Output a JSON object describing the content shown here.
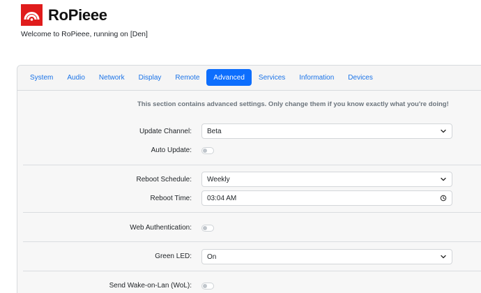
{
  "brand": {
    "title": "RoPieee",
    "logo_color": "#e01c1c"
  },
  "welcome": "Welcome to RoPieee, running on [Den]",
  "tabs": [
    {
      "label": "System",
      "active": false
    },
    {
      "label": "Audio",
      "active": false
    },
    {
      "label": "Network",
      "active": false
    },
    {
      "label": "Display",
      "active": false
    },
    {
      "label": "Remote",
      "active": false
    },
    {
      "label": "Advanced",
      "active": true
    },
    {
      "label": "Services",
      "active": false
    },
    {
      "label": "Information",
      "active": false
    },
    {
      "label": "Devices",
      "active": false
    }
  ],
  "notice": "This section contains advanced settings. Only change them if you know exactly what you're doing!",
  "settings": {
    "update_channel": {
      "label": "Update Channel:",
      "value": "Beta"
    },
    "auto_update": {
      "label": "Auto Update:",
      "enabled": false
    },
    "reboot_schedule": {
      "label": "Reboot Schedule:",
      "value": "Weekly"
    },
    "reboot_time": {
      "label": "Reboot Time:",
      "value": "03:04 AM"
    },
    "web_auth": {
      "label": "Web Authentication:",
      "enabled": false
    },
    "green_led": {
      "label": "Green LED:",
      "value": "On"
    },
    "wol": {
      "label": "Send Wake-on-Lan (WoL):",
      "enabled": false
    }
  },
  "icons": {
    "chevron": "chevron-down-icon",
    "clock": "clock-icon"
  },
  "colors": {
    "primary": "#0d6efd",
    "link": "#1a73e8"
  }
}
